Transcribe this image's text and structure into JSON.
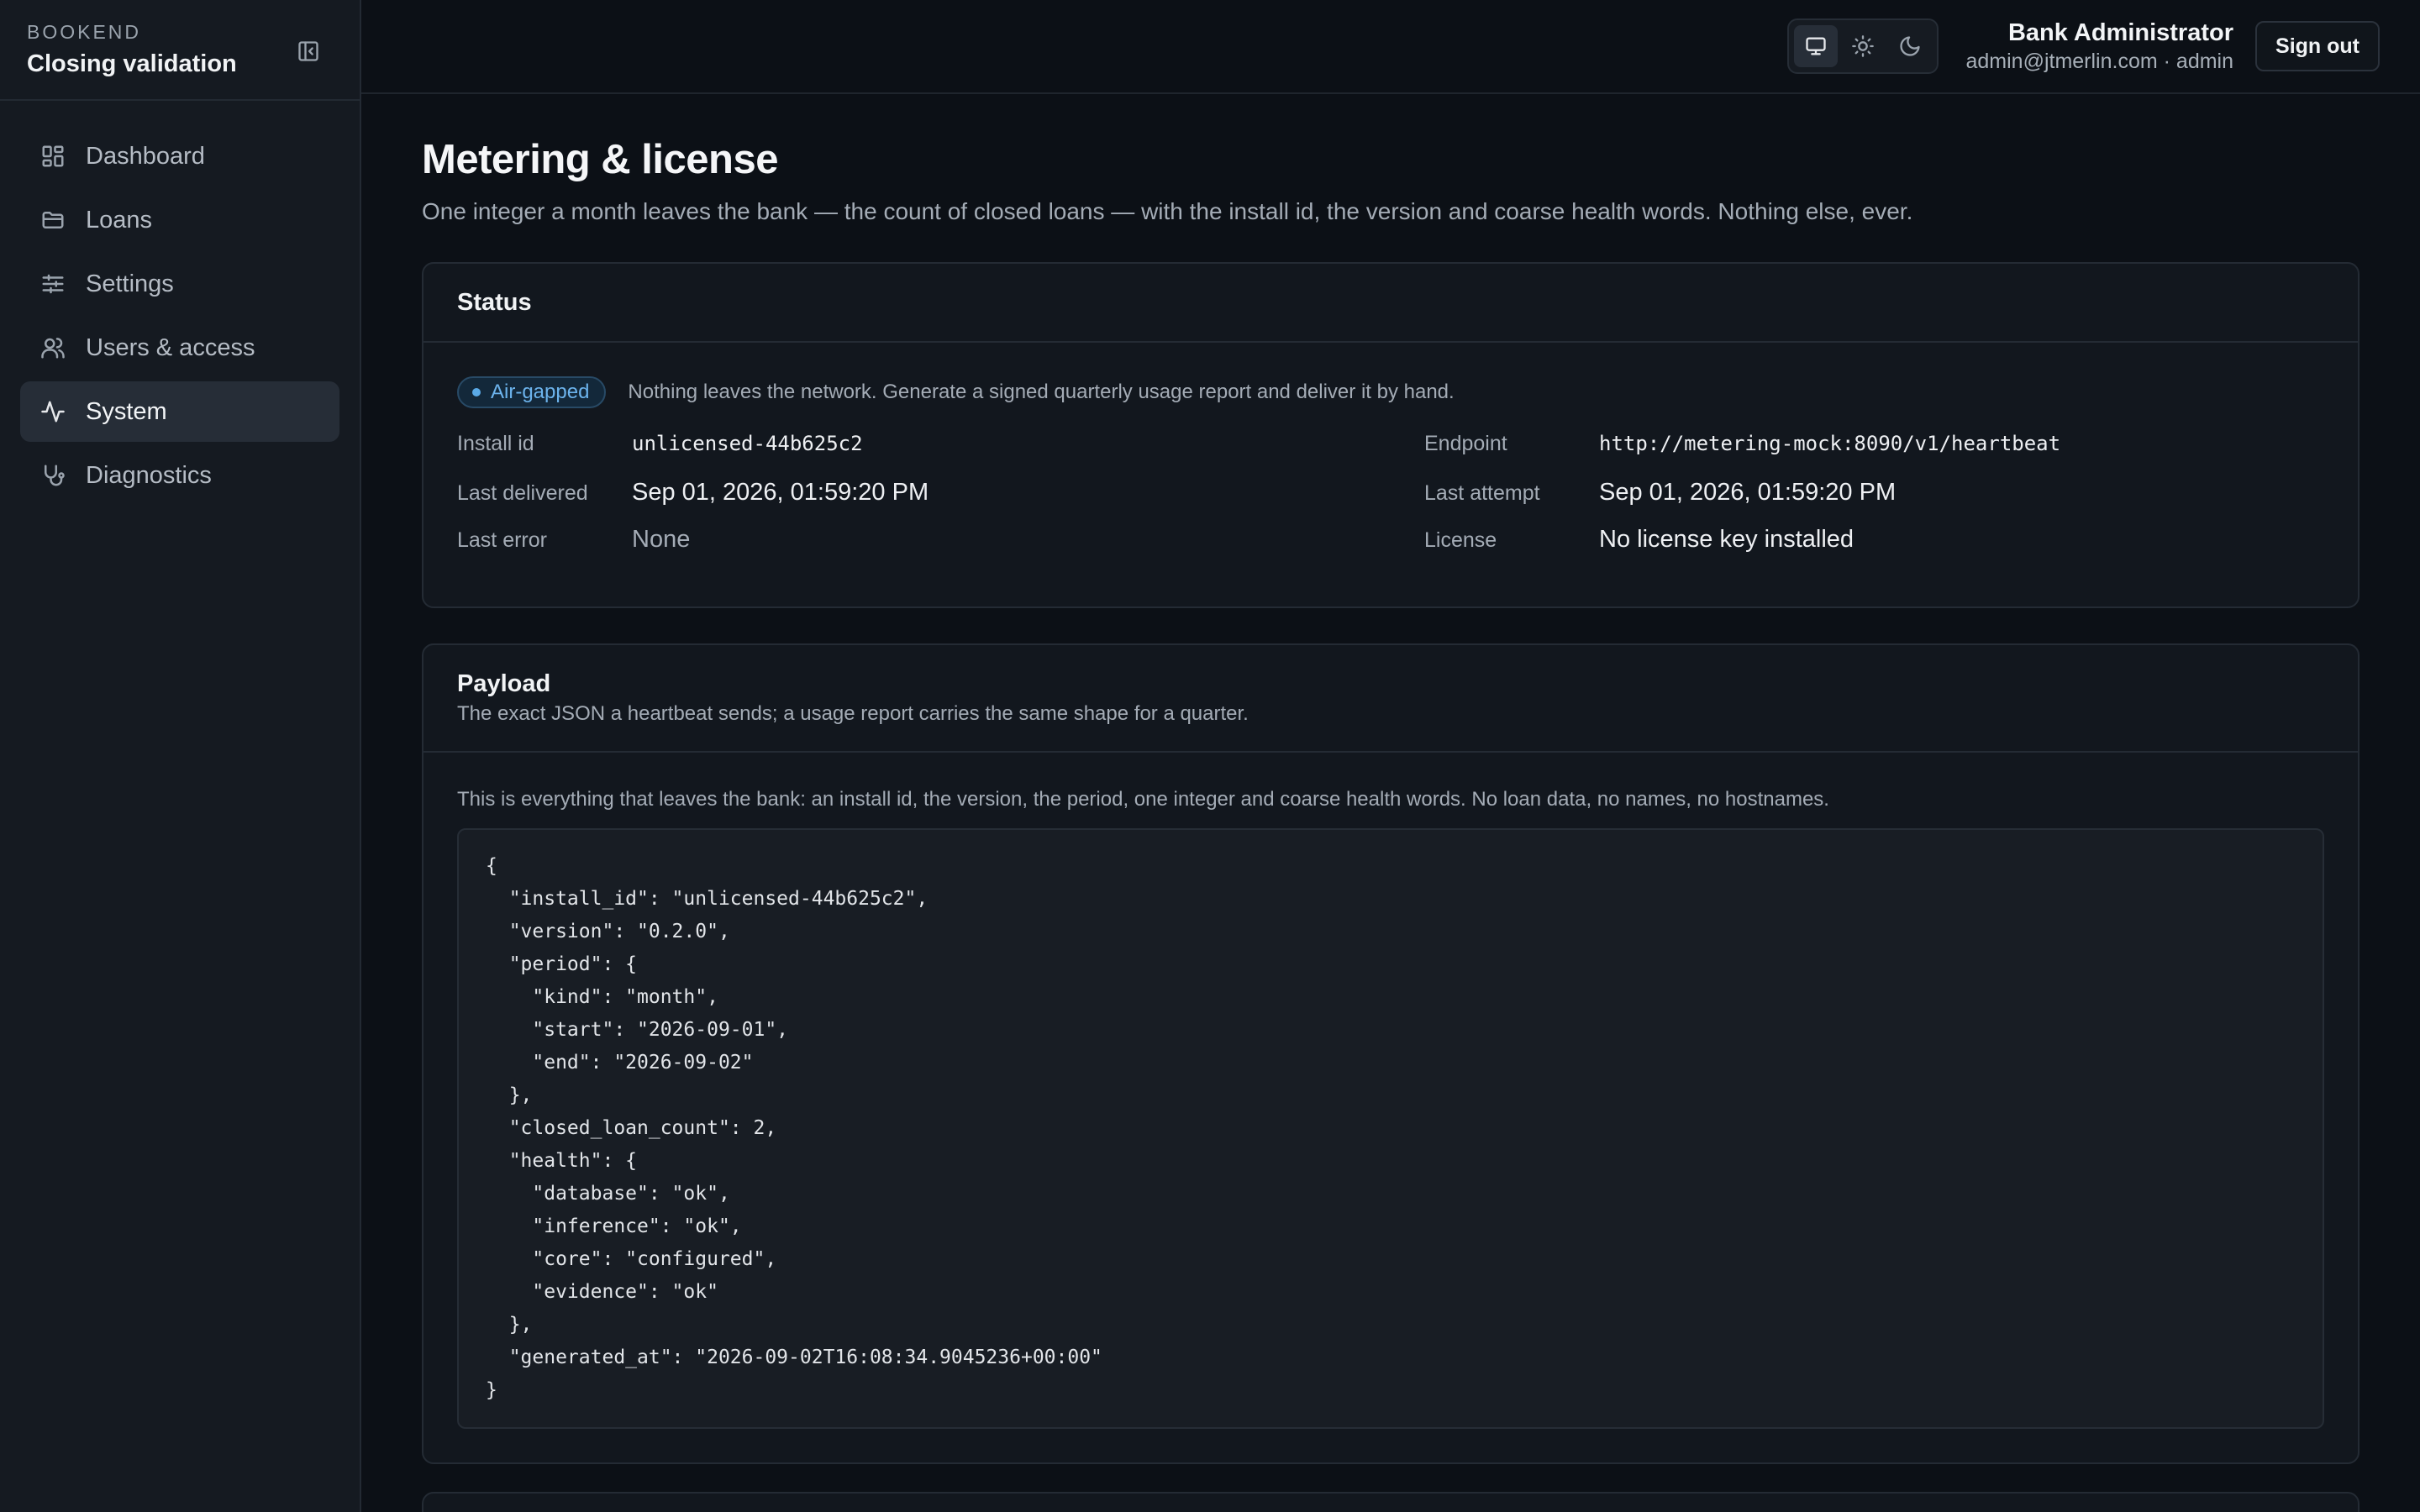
{
  "brand": {
    "eyebrow": "BOOKEND",
    "title": "Closing validation"
  },
  "nav": [
    {
      "label": "Dashboard",
      "icon": "dashboard-icon"
    },
    {
      "label": "Loans",
      "icon": "folder-icon"
    },
    {
      "label": "Settings",
      "icon": "sliders-icon"
    },
    {
      "label": "Users & access",
      "icon": "users-icon"
    },
    {
      "label": "System",
      "icon": "activity-icon",
      "active": true
    },
    {
      "label": "Diagnostics",
      "icon": "stethoscope-icon"
    }
  ],
  "topbar": {
    "user_name": "Bank Administrator",
    "user_email": "admin@jtmerlin.com · admin",
    "sign_out": "Sign out",
    "theme_options": [
      "system",
      "light",
      "dark"
    ],
    "theme_selected": "system"
  },
  "page": {
    "title": "Metering & license",
    "subtitle": "One integer a month leaves the bank — the count of closed loans — with the install id, the version and coarse health words. Nothing else, ever."
  },
  "status": {
    "title": "Status",
    "badge": "Air-gapped",
    "note": "Nothing leaves the network. Generate a signed quarterly usage report and deliver it by hand.",
    "left": [
      {
        "label": "Install id",
        "value": "unlicensed-44b625c2"
      },
      {
        "label": "Last delivered",
        "value": "Sep 01, 2026, 01:59:20 PM"
      },
      {
        "label": "Last error",
        "value": "None"
      }
    ],
    "right": [
      {
        "label": "Endpoint",
        "value": "http://metering-mock:8090/v1/heartbeat"
      },
      {
        "label": "Last attempt",
        "value": "Sep 01, 2026, 01:59:20 PM"
      },
      {
        "label": "License",
        "value": "No license key installed"
      }
    ]
  },
  "payload": {
    "title": "Payload",
    "description": "The exact JSON a heartbeat sends; a usage report carries the same shape for a quarter.",
    "note": "This is everything that leaves the bank: an install id, the version, the period, one integer and coarse health words. No loan data, no names, no hostnames.",
    "json": "{\n  \"install_id\": \"unlicensed-44b625c2\",\n  \"version\": \"0.2.0\",\n  \"period\": {\n    \"kind\": \"month\",\n    \"start\": \"2026-09-01\",\n    \"end\": \"2026-09-02\"\n  },\n  \"closed_loan_count\": 2,\n  \"health\": {\n    \"database\": \"ok\",\n    \"inference\": \"ok\",\n    \"core\": \"configured\",\n    \"evidence\": \"ok\"\n  },\n  \"generated_at\": \"2026-09-02T16:08:34.9045236+00:00\"\n}"
  },
  "colors": {
    "background": "#0c1016",
    "sidebar": "#151a21",
    "accent": "#5aa9e6"
  }
}
